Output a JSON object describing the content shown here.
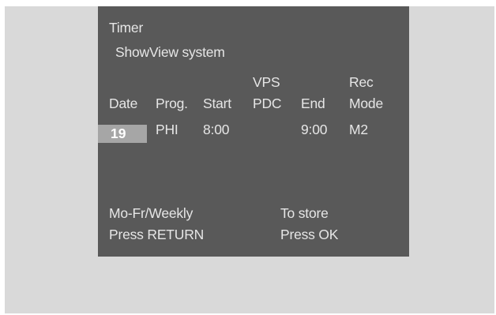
{
  "menu": {
    "title": "Timer",
    "subtitle": "ShowView system"
  },
  "columns": {
    "date": "Date",
    "prog": "Prog.",
    "start": "Start",
    "vps_line1": "VPS",
    "vps_line2": "PDC",
    "end": "End",
    "rec_line1": "Rec",
    "rec_line2": "Mode"
  },
  "entry": {
    "date": "19",
    "prog": "PHI",
    "start": "8:00",
    "vps_pdc": "",
    "end": "9:00",
    "rec_mode": "M2"
  },
  "hints": {
    "left_line1": "Mo-Fr/Weekly",
    "left_line2": "Press RETURN",
    "right_line1": "To store",
    "right_line2": "Press OK"
  },
  "colors": {
    "panel": "#595959",
    "background": "#d9d9d9",
    "highlight": "#a6a6a6",
    "text": "#e6e6e6"
  }
}
